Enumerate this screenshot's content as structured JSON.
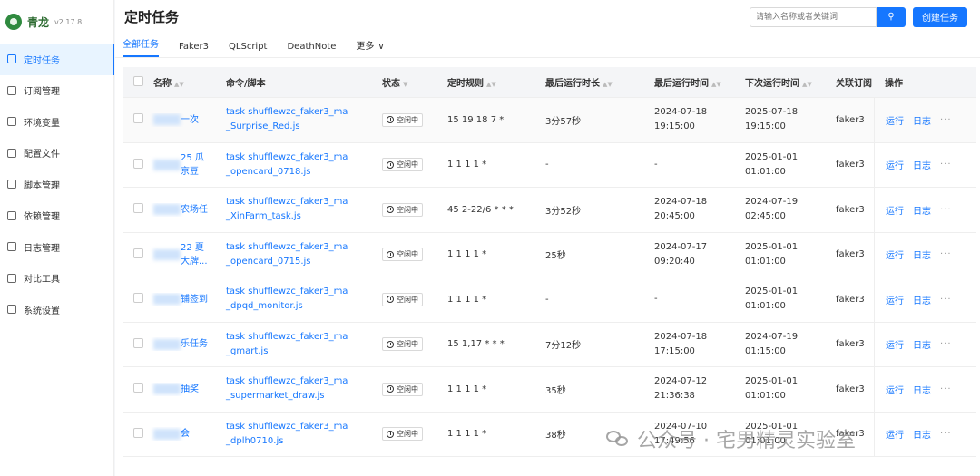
{
  "brand": {
    "name": "青龙",
    "version": "v2.17.8"
  },
  "sidebar": {
    "items": [
      {
        "label": "定时任务",
        "icon": "calendar-icon",
        "active": true
      },
      {
        "label": "订阅管理",
        "icon": "subscription-icon"
      },
      {
        "label": "环境变量",
        "icon": "desktop-icon"
      },
      {
        "label": "配置文件",
        "icon": "sliders-icon"
      },
      {
        "label": "脚本管理",
        "icon": "folder-icon"
      },
      {
        "label": "依赖管理",
        "icon": "dependency-icon"
      },
      {
        "label": "日志管理",
        "icon": "calendar-log-icon"
      },
      {
        "label": "对比工具",
        "icon": "diff-icon"
      },
      {
        "label": "系统设置",
        "icon": "gear-icon"
      }
    ]
  },
  "header": {
    "title": "定时任务",
    "search_placeholder": "请输入名称或者关键词",
    "create_label": "创建任务"
  },
  "tabs": [
    {
      "label": "全部任务",
      "active": true
    },
    {
      "label": "Faker3"
    },
    {
      "label": "QLScript"
    },
    {
      "label": "DeathNote"
    },
    {
      "label": "更多"
    }
  ],
  "table": {
    "columns": [
      "名称",
      "命令/脚本",
      "状态",
      "定时规则",
      "最后运行时长",
      "最后运行时间",
      "下次运行时间",
      "关联订阅",
      "操作"
    ],
    "status_label": "空闲中",
    "actions": {
      "run": "运行",
      "log": "日志",
      "more": "···"
    },
    "rows": [
      {
        "name": "一次",
        "cmd1": "task shufflewzc_faker3_ma",
        "cmd2": "_Surprise_Red.js",
        "cron": "15 19 18 7 *",
        "duration": "3分57秒",
        "last1": "2024-07-18",
        "last2": "19:15:00",
        "next1": "2025-07-18",
        "next2": "19:15:00",
        "sub": "faker3"
      },
      {
        "name": "25 瓜\n京豆",
        "cmd1": "task shufflewzc_faker3_ma",
        "cmd2": "_opencard_0718.js",
        "cron": "1 1 1 1 *",
        "duration": "-",
        "last1": "-",
        "last2": "",
        "next1": "2025-01-01",
        "next2": "01:01:00",
        "sub": "faker3"
      },
      {
        "name": "农场任",
        "cmd1": "task shufflewzc_faker3_ma",
        "cmd2": "_XinFarm_task.js",
        "cron": "45 2-22/6 * * *",
        "duration": "3分52秒",
        "last1": "2024-07-18",
        "last2": "20:45:00",
        "next1": "2024-07-19",
        "next2": "02:45:00",
        "sub": "faker3"
      },
      {
        "name": "22 夏\n大牌...",
        "cmd1": "task shufflewzc_faker3_ma",
        "cmd2": "_opencard_0715.js",
        "cron": "1 1 1 1 *",
        "duration": "25秒",
        "last1": "2024-07-17",
        "last2": "09:20:40",
        "next1": "2025-01-01",
        "next2": "01:01:00",
        "sub": "faker3"
      },
      {
        "name": "铺签到",
        "cmd1": "task shufflewzc_faker3_ma",
        "cmd2": "_dpqd_monitor.js",
        "cron": "1 1 1 1 *",
        "duration": "-",
        "last1": "-",
        "last2": "",
        "next1": "2025-01-01",
        "next2": "01:01:00",
        "sub": "faker3"
      },
      {
        "name": "乐任务",
        "cmd1": "task shufflewzc_faker3_ma",
        "cmd2": "_gmart.js",
        "cron": "15 1,17 * * *",
        "duration": "7分12秒",
        "last1": "2024-07-18",
        "last2": "17:15:00",
        "next1": "2024-07-19",
        "next2": "01:15:00",
        "sub": "faker3"
      },
      {
        "name": "抽奖",
        "cmd1": "task shufflewzc_faker3_ma",
        "cmd2": "_supermarket_draw.js",
        "cron": "1 1 1 1 *",
        "duration": "35秒",
        "last1": "2024-07-12",
        "last2": "21:36:38",
        "next1": "2025-01-01",
        "next2": "01:01:00",
        "sub": "faker3"
      },
      {
        "name": "会",
        "cmd1": "task shufflewzc_faker3_ma",
        "cmd2": "_dplh0710.js",
        "cron": "1 1 1 1 *",
        "duration": "38秒",
        "last1": "2024-07-10",
        "last2": "17:49:56",
        "next1": "2025-01-01",
        "next2": "01:01:00",
        "sub": "faker3"
      }
    ]
  },
  "watermark": {
    "text": "公众号 · 宅男精灵实验室"
  }
}
